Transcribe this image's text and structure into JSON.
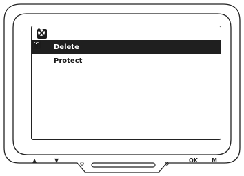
{
  "tabs": [
    {
      "icon": "playback-icon",
      "active": true
    },
    {
      "icon": "settings-tools-icon",
      "active": false
    }
  ],
  "menu": {
    "items": [
      {
        "label": "Delete",
        "icon": "trash-icon",
        "selected": true
      },
      {
        "label": "Protect",
        "icon": "lock-icon",
        "selected": false
      }
    ]
  },
  "hardware": {
    "up_label": "▲",
    "down_label": "▼",
    "ok_label": "OK",
    "menu_label": "M"
  }
}
